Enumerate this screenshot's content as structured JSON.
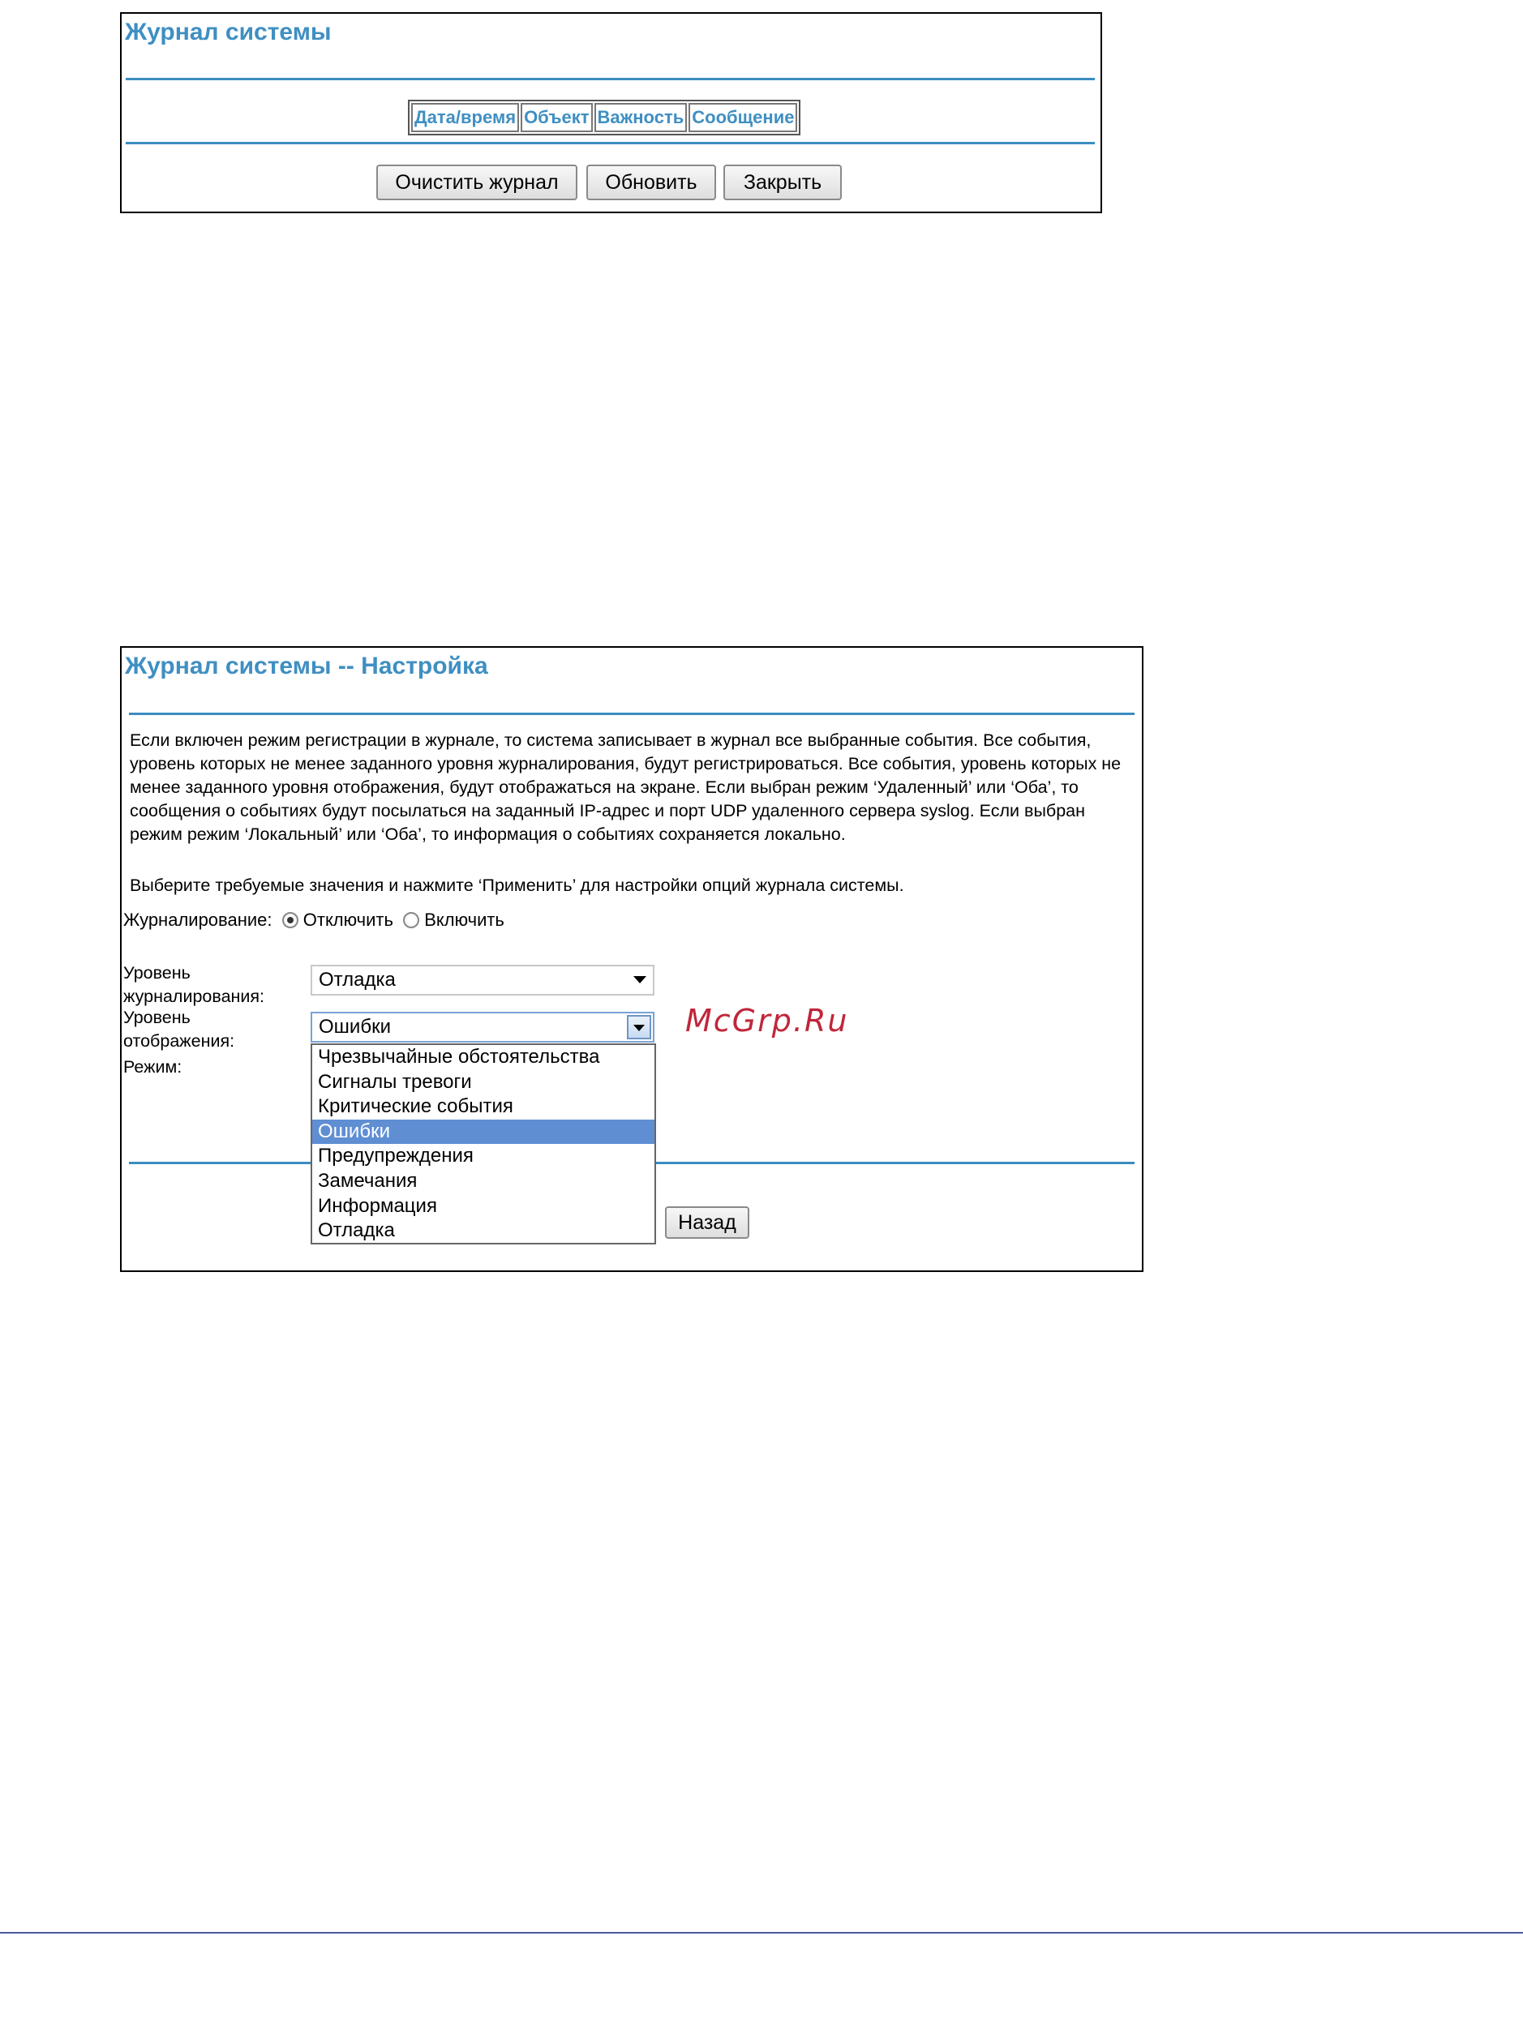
{
  "log_panel": {
    "title": "Журнал системы",
    "columns": [
      "Дата/время",
      "Объект",
      "Важность",
      "Сообщение"
    ],
    "buttons": {
      "clear": "Очистить журнал",
      "refresh": "Обновить",
      "close": "Закрыть"
    }
  },
  "config_panel": {
    "title": "Журнал системы -- Настройка",
    "description": "Если включен режим регистрации в журнале, то система записывает в журнал все выбранные события. Все события, уровень которых не менее заданного уровня журналирования, будут регистрироваться. Все события, уровень которых не менее заданного уровня отображения, будут отображаться на экране. Если выбран режим ‘Удаленный’ или ‘Оба’, то сообщения о событиях будут посылаться на заданный IP-адрес и порт UDP удаленного сервера syslog. Если выбран режим режим ‘Локальный’ или ‘Оба’, то информация о событиях сохраняется локально.",
    "instruction": "Выберите требуемые значения и нажмите ‘Применить’ для настройки опций журнала системы.",
    "logging": {
      "label": "Журналирование:",
      "options": [
        {
          "label": "Отключить",
          "selected": true
        },
        {
          "label": "Включить",
          "selected": false
        }
      ]
    },
    "log_level": {
      "label_line1": "Уровень",
      "label_line2": "журналирования:",
      "value": "Отладка"
    },
    "display_level": {
      "label_line1": "Уровень",
      "label_line2": "отображения:",
      "value": "Ошибки",
      "options": [
        "Чрезвычайные обстоятельства",
        "Сигналы тревоги",
        "Критические события",
        "Ошибки",
        "Предупреждения",
        "Замечания",
        "Информация",
        "Отладка"
      ],
      "highlighted_index": 3,
      "highlight_color": "#5f8ed3"
    },
    "mode": {
      "label": "Режим:"
    },
    "back_button": "Назад"
  },
  "watermark": "McGrp.Ru",
  "accent_color": "#3f8fc2"
}
